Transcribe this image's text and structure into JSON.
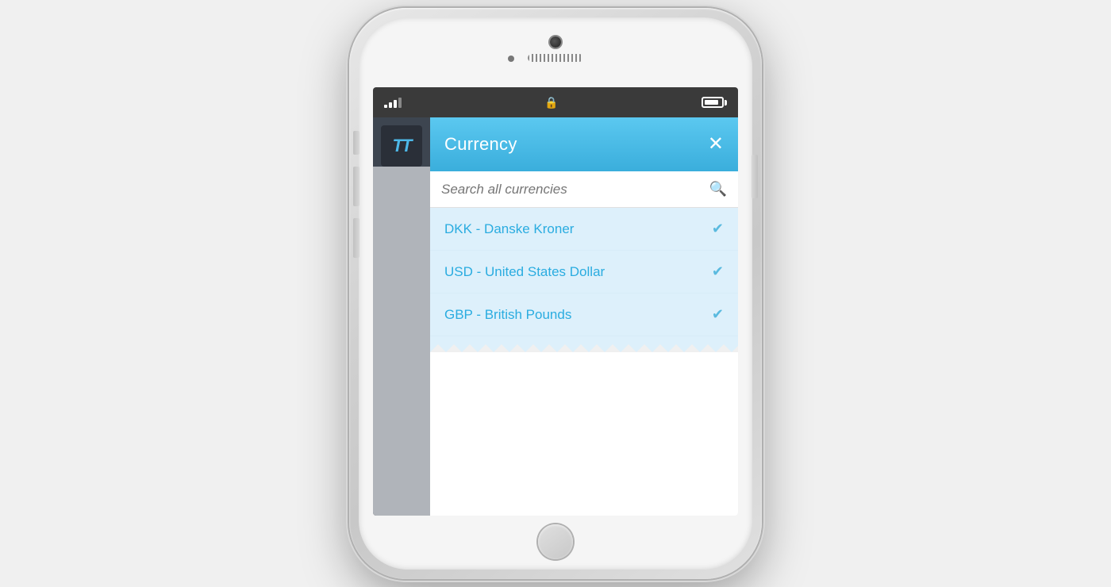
{
  "phone": {
    "status_bar": {
      "signal_label": "signal",
      "lock_label": "🔒",
      "battery_label": "battery"
    },
    "app": {
      "sidebar": {
        "logo_text": "TT"
      },
      "header": {
        "title": "Currency",
        "close_button": "✕"
      },
      "search": {
        "placeholder": "Search all currencies",
        "icon": "🔍"
      },
      "currency_list": [
        {
          "code": "DKK",
          "name": "Danske Kroner",
          "label": "DKK - Danske Kroner",
          "selected": true
        },
        {
          "code": "USD",
          "name": "United States Dollar",
          "label": "USD - United States Dollar",
          "selected": true
        },
        {
          "code": "GBP",
          "name": "British Pounds",
          "label": "GBP - British Pounds",
          "selected": true
        }
      ]
    }
  }
}
